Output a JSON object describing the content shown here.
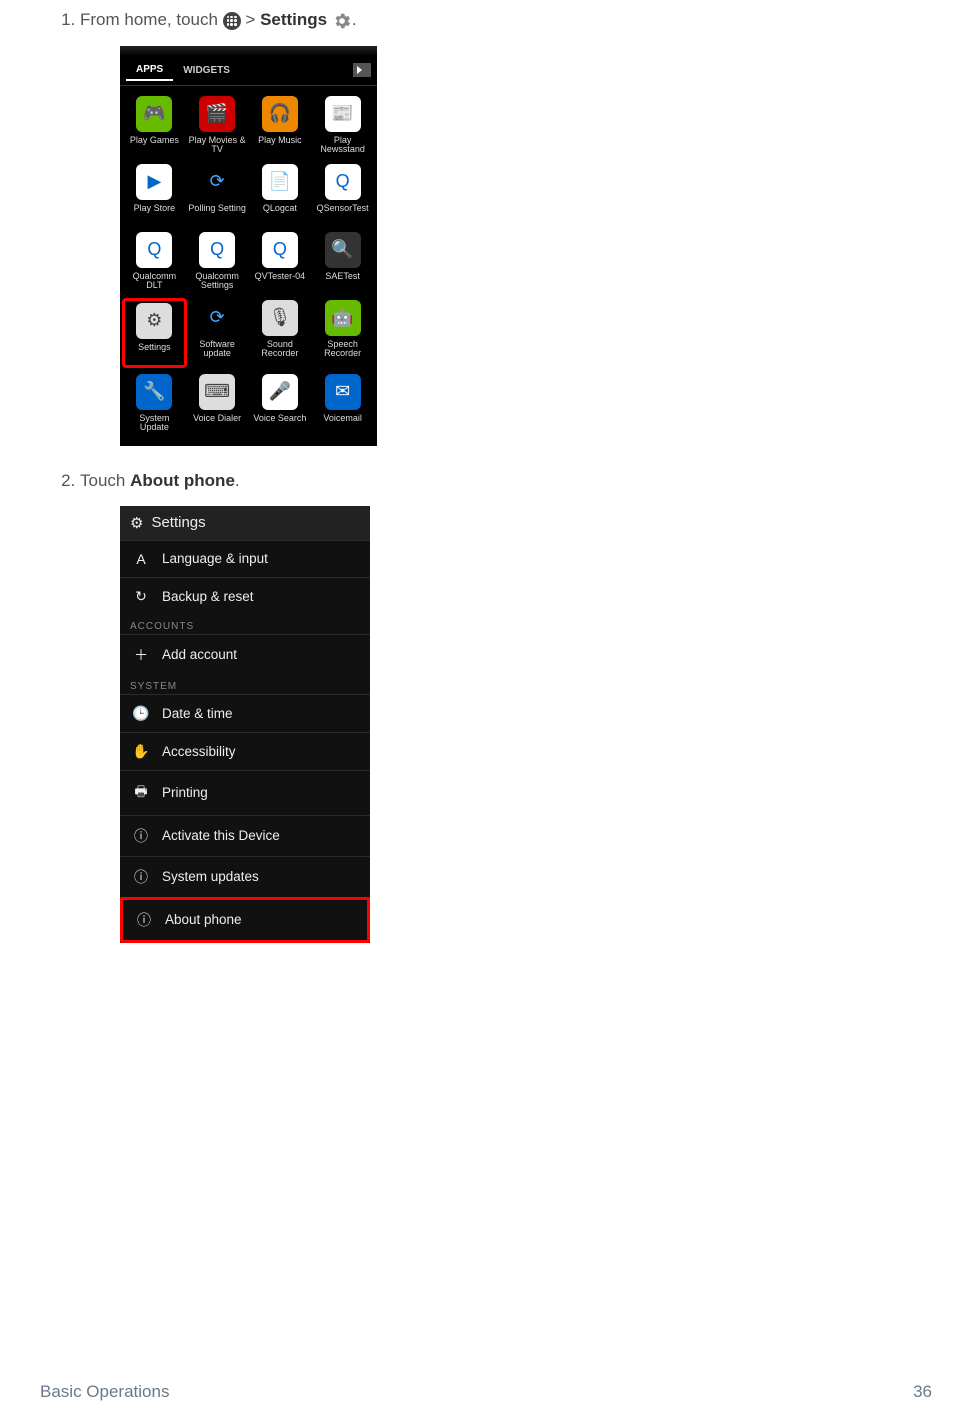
{
  "step1": {
    "prefix": "From home, touch ",
    "sep": " > ",
    "settings_word": "Settings",
    "suffix": "."
  },
  "step2": {
    "prefix": "Touch ",
    "bold": "About phone",
    "suffix": "."
  },
  "shot1": {
    "tab_apps": "APPS",
    "tab_widgets": "WIDGETS",
    "apps": [
      {
        "label": "Play Games",
        "bg": "bg-green",
        "glyph": "🎮"
      },
      {
        "label": "Play Movies & TV",
        "bg": "bg-red",
        "glyph": "🎬"
      },
      {
        "label": "Play Music",
        "bg": "bg-orange",
        "glyph": "🎧"
      },
      {
        "label": "Play Newsstand",
        "bg": "bg-white",
        "glyph": "📰"
      },
      {
        "label": "Play Store",
        "bg": "bg-white",
        "glyph": "▶"
      },
      {
        "label": "Polling Setting",
        "bg": "bg-sync",
        "glyph": "⟳"
      },
      {
        "label": "QLogcat",
        "bg": "bg-white",
        "glyph": "📄"
      },
      {
        "label": "QSensorTest",
        "bg": "bg-white",
        "glyph": "Q"
      },
      {
        "label": "Qualcomm DLT",
        "bg": "bg-white",
        "glyph": "Q"
      },
      {
        "label": "Qualcomm Settings",
        "bg": "bg-white",
        "glyph": "Q"
      },
      {
        "label": "QVTester-04",
        "bg": "bg-white",
        "glyph": "Q"
      },
      {
        "label": "SAETest",
        "bg": "bg-dark",
        "glyph": "🔍"
      },
      {
        "label": "Settings",
        "bg": "bg-grey",
        "glyph": "⚙",
        "hl": true
      },
      {
        "label": "Software update",
        "bg": "bg-sync",
        "glyph": "⟳"
      },
      {
        "label": "Sound Recorder",
        "bg": "bg-grey",
        "glyph": "🎙"
      },
      {
        "label": "Speech Recorder",
        "bg": "bg-green",
        "glyph": "🤖"
      },
      {
        "label": "System Update",
        "bg": "bg-blue",
        "glyph": "🔧"
      },
      {
        "label": "Voice Dialer",
        "bg": "bg-grey",
        "glyph": "⌨"
      },
      {
        "label": "Voice Search",
        "bg": "bg-white",
        "glyph": "🎤"
      },
      {
        "label": "Voicemail",
        "bg": "bg-blue",
        "glyph": "✉"
      }
    ]
  },
  "shot2": {
    "header": "Settings",
    "rows": [
      {
        "type": "item",
        "icon": "A",
        "label": "Language & input"
      },
      {
        "type": "item",
        "icon": "↻",
        "label": "Backup & reset"
      },
      {
        "type": "section",
        "label": "ACCOUNTS"
      },
      {
        "type": "item",
        "icon": "＋",
        "label": "Add account"
      },
      {
        "type": "section",
        "label": "SYSTEM"
      },
      {
        "type": "item",
        "icon": "🕒",
        "label": "Date & time"
      },
      {
        "type": "item",
        "icon": "✋",
        "label": "Accessibility"
      },
      {
        "type": "item",
        "icon": "🖶",
        "label": "Printing"
      },
      {
        "type": "item",
        "icon": "ⓘ",
        "label": "Activate this Device"
      },
      {
        "type": "item",
        "icon": "ⓘ",
        "label": "System updates"
      },
      {
        "type": "item",
        "icon": "ⓘ",
        "label": "About phone",
        "hl": true
      }
    ]
  },
  "footer": {
    "left": "Basic Operations",
    "right": "36"
  }
}
